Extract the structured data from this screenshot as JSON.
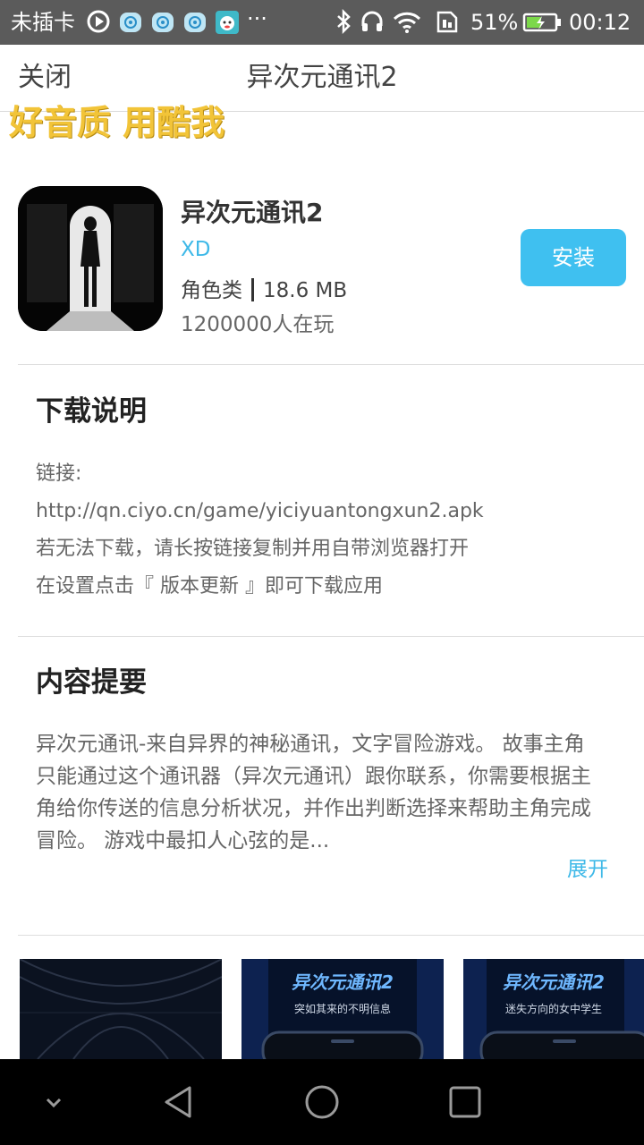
{
  "status": {
    "carrier": "未插卡",
    "battery": "51%",
    "time": "00:12",
    "more": "···",
    "icons": [
      "play-circle-icon",
      "signal-badge-icon",
      "signal-badge-icon",
      "signal-badge-icon",
      "app-badge-icon",
      "bluetooth-icon",
      "headphones-icon",
      "wifi-icon",
      "sim-icon",
      "battery-icon"
    ]
  },
  "appbar": {
    "close_label": "关闭",
    "title": "异次元通讯2"
  },
  "banner": "好音质 用酷我",
  "app": {
    "name": "异次元通讯2",
    "developer": "XD",
    "category": "角色类",
    "size": "18.6 MB",
    "players": "1200000人在玩",
    "install_label": "安装"
  },
  "download": {
    "title": "下载说明",
    "lines": [
      "链接:",
      "http://qn.ciyo.cn/game/yiciyuantongxun2.apk",
      "若无法下载，请长按链接复制并用自带浏览器打开",
      "在设置点击『 版本更新 』即可下载应用"
    ]
  },
  "summary": {
    "title": "内容提要",
    "text": "异次元通讯-来自异界的神秘通讯，文字冒险游戏。 故事主角只能通过这个通讯器（异次元通讯）跟你联系，你需要根据主角给你传送的信息分析状况，并作出判断选择来帮助主角完成冒险。 游戏中最扣人心弦的是...",
    "expand_label": "展开"
  },
  "screenshots": [
    {
      "logo": "",
      "caption": ""
    },
    {
      "logo": "异次元通讯2",
      "caption": "突如其来的不明信息"
    },
    {
      "logo": "异次元通讯2",
      "caption": "迷失方向的女中学生"
    }
  ],
  "colors": {
    "accent": "#3fc0f0",
    "banner": "#f2c438",
    "statusbar": "#5b5b5b"
  }
}
